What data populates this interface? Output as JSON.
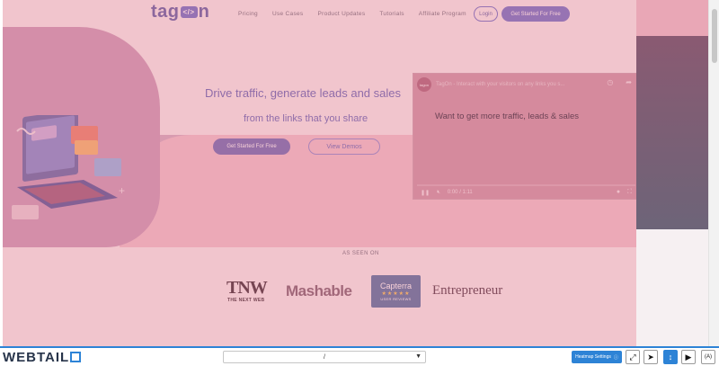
{
  "header": {
    "logo_text_left": "tag",
    "logo_tag": "</>",
    "logo_text_right": "n",
    "nav": [
      "Pricing",
      "Use Cases",
      "Product Updates",
      "Tutorials",
      "Affiliate Program"
    ],
    "login": "Login",
    "cta": "Get Started For Free"
  },
  "hero": {
    "headline": "Drive traffic, generate leads and sales",
    "subline": "from the links that you share",
    "primary_button": "Get Started For Free",
    "secondary_button": "View Demos"
  },
  "video": {
    "avatar": "tagon",
    "title": "TagOn - Interact with your visitors on any links you s...",
    "watch_later": "Watch later",
    "share": "Share",
    "caption": "Want to get more traffic, leads & sales",
    "time": "0:00 / 1:11"
  },
  "press": {
    "label": "AS SEEN ON",
    "tnw": "TNW",
    "tnw_sub": "THE NEXT WEB",
    "mashable": "Mashable",
    "capterra_title": "Capterra",
    "capterra_stars": "★★★★★",
    "capterra_sub": "USER REVIEWS",
    "entrepreneur": "Entrepreneur"
  },
  "toolbar": {
    "brand_left": "WEBTAIL",
    "url_value": "/",
    "heatmap_settings": "Heatmap Settings",
    "colors": {
      "accent": "#2d83d6"
    }
  }
}
